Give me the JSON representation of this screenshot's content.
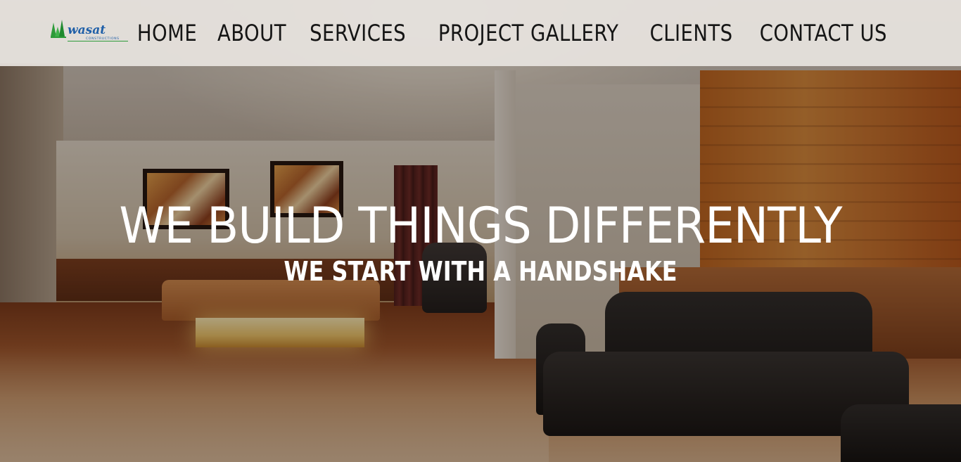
{
  "header": {
    "logo_alt": "wasat constructions",
    "logo_text": "wasat",
    "logo_subtext": "CONSTRUCTIONS",
    "nav": [
      {
        "label": "HOME"
      },
      {
        "label": "ABOUT"
      },
      {
        "label": "SERVICES"
      },
      {
        "label": "PROJECT GALLERY"
      },
      {
        "label": "CLIENTS"
      },
      {
        "label": "CONTACT US"
      }
    ]
  },
  "hero": {
    "headline": "WE BUILD THINGS DIFFERENTLY",
    "subheadline": "WE START WITH A HANDSHAKE"
  },
  "colors": {
    "navbar_bg": "#e8e4e0",
    "nav_text": "#151515",
    "hero_text": "#ffffff",
    "logo_green": "#2e9b3a",
    "logo_blue": "#1f5fa8"
  }
}
